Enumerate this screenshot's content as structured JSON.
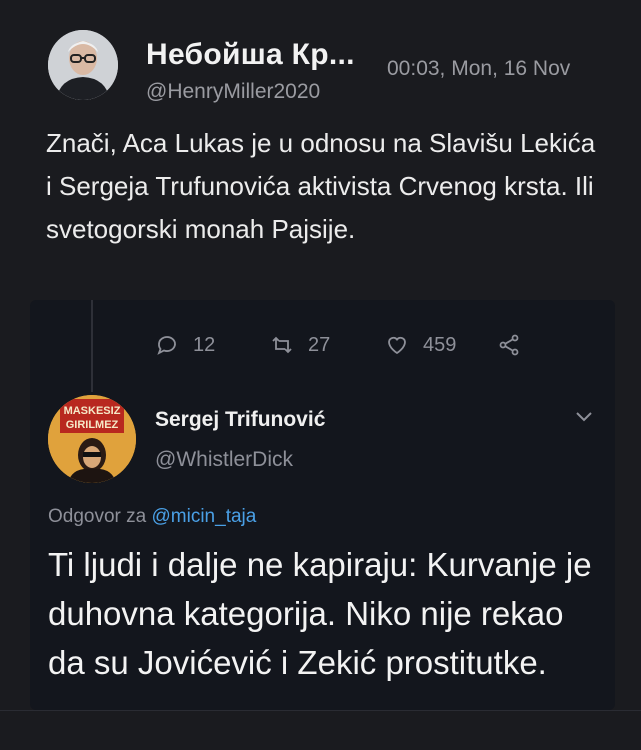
{
  "tweet": {
    "author_name": "Небойша Кр...",
    "handle": "@HenryMiller2020",
    "timestamp": "00:03, Mon, 16 Nov",
    "text": "Znači, Aca Lukas je u odnosu na Slavišu Lekića i Sergeja Trufunovića aktivista Crvenog krsta. Ili svetogorski monah Pajsije.",
    "actions": {
      "reply_count": "12",
      "retweet_count": "27",
      "like_count": "459"
    }
  },
  "quoted": {
    "author_name": "Sergej Trifunović",
    "handle": "@WhistlerDick",
    "avatar_text_line1": "MASKESIZ",
    "avatar_text_line2": "GIRILMEZ",
    "reply_prefix": "Odgovor za ",
    "reply_mention": "@micin_taja",
    "text": "Ti ljudi i dalje ne kapiraju: Kurvanje je duhovna kategorija. Niko nije rekao da su Jovićević i Zekić prostitutke."
  },
  "colors": {
    "background": "#1a1b1f",
    "card": "#13161d",
    "mention": "#4aa0e6",
    "muted": "#8e9099"
  },
  "icons": [
    "reply-icon",
    "retweet-icon",
    "like-icon",
    "share-icon",
    "chevron-down-icon"
  ]
}
